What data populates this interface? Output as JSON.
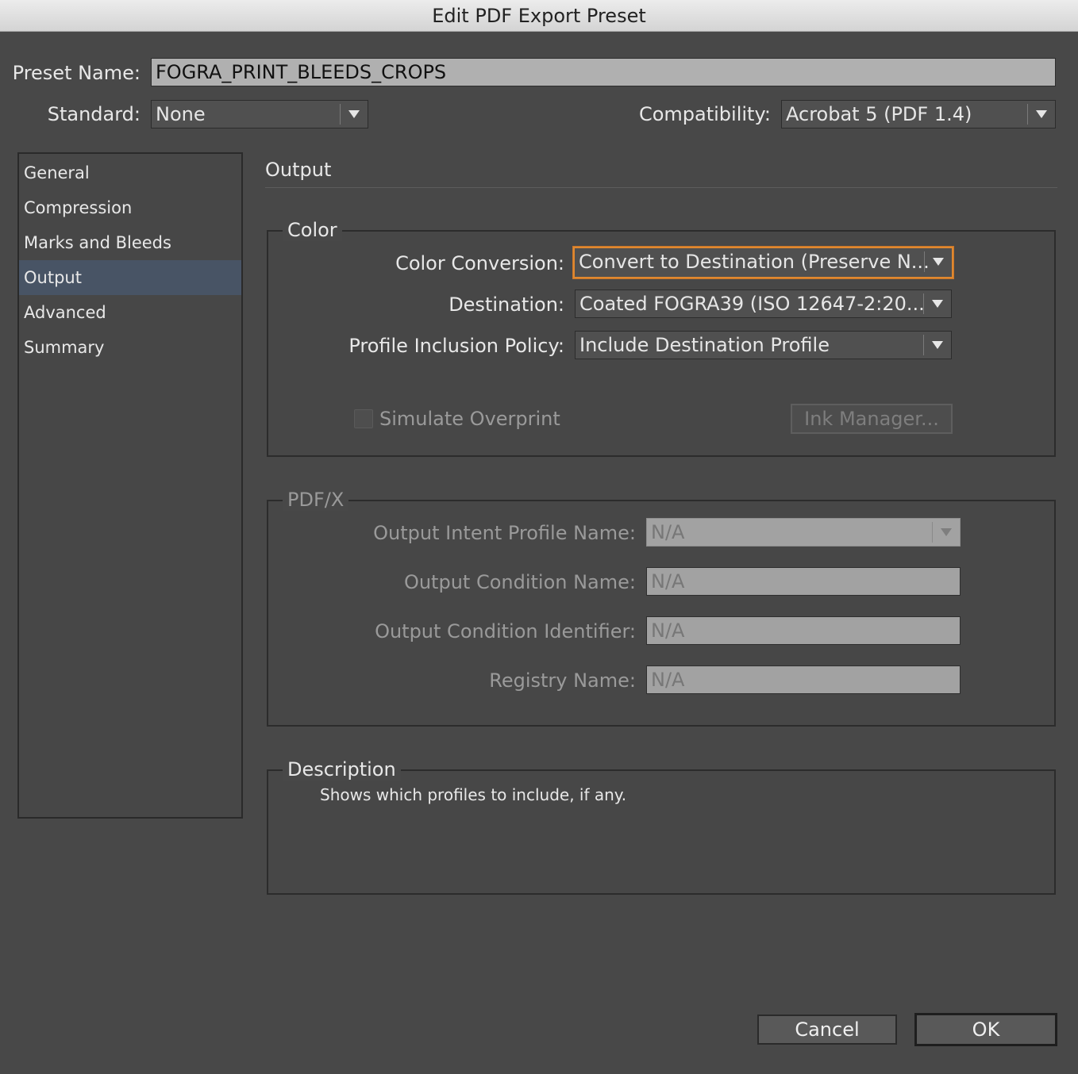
{
  "window": {
    "title": "Edit PDF Export Preset"
  },
  "preset_name": {
    "label": "Preset Name:",
    "value": "FOGRA_PRINT_BLEEDS_CROPS"
  },
  "standard": {
    "label": "Standard:",
    "value": "None"
  },
  "compatibility": {
    "label": "Compatibility:",
    "value": "Acrobat 5 (PDF 1.4)"
  },
  "sidebar": {
    "items": [
      {
        "label": "General"
      },
      {
        "label": "Compression"
      },
      {
        "label": "Marks and Bleeds"
      },
      {
        "label": "Output",
        "selected": true
      },
      {
        "label": "Advanced"
      },
      {
        "label": "Summary"
      }
    ]
  },
  "section": {
    "title": "Output"
  },
  "color_group": {
    "legend": "Color",
    "color_conversion": {
      "label": "Color Conversion:",
      "value": "Convert to Destination (Preserve N..."
    },
    "destination": {
      "label": "Destination:",
      "value": "Coated FOGRA39 (ISO 12647-2:20..."
    },
    "profile_policy": {
      "label": "Profile Inclusion Policy:",
      "value": "Include Destination Profile"
    },
    "simulate_overprint": {
      "label": "Simulate Overprint",
      "checked": false,
      "enabled": false
    },
    "ink_manager": {
      "label": "Ink Manager...",
      "enabled": false
    }
  },
  "pdfx_group": {
    "legend": "PDF/X",
    "output_intent": {
      "label": "Output Intent Profile Name:",
      "value": "N/A"
    },
    "output_condition_name": {
      "label": "Output Condition Name:",
      "value": "N/A"
    },
    "output_condition_identifier": {
      "label": "Output Condition Identifier:",
      "value": "N/A"
    },
    "registry_name": {
      "label": "Registry Name:",
      "value": "N/A"
    }
  },
  "description_group": {
    "legend": "Description",
    "text": "Shows which profiles to include, if any."
  },
  "buttons": {
    "cancel": "Cancel",
    "ok": "OK"
  },
  "colors": {
    "focus_ring": "#e0882f",
    "selection": "#485465",
    "background": "#484848"
  }
}
